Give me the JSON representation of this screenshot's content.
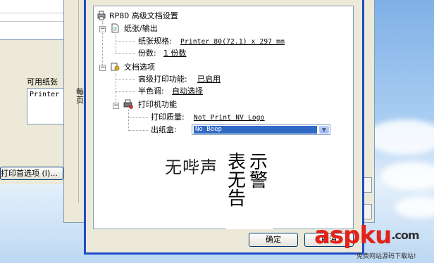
{
  "back_window": {
    "available_paper_label": "可用纸张",
    "printer_list_item": "Printer",
    "print_prefs_button": "打印首选项 (I)..."
  },
  "middle_window": {
    "label_1": "每",
    "label_2": "页"
  },
  "tree": {
    "root": "RP80 高级文档设置",
    "paper_output": "纸张/输出",
    "paper_size_label": "纸张规格:",
    "paper_size_value": "Printer 80(72.1) x 297 mm",
    "copies_label": "份数:",
    "copies_value": "1 份数",
    "doc_options": "文档选项",
    "adv_print_label": "高级打印功能:",
    "adv_print_value": "已启用",
    "halftone_label": "半色调:",
    "halftone_value": "自动选择",
    "printer_features": "打印机功能",
    "print_quality_label": "打印质量:",
    "print_quality_value": "Not Print NV Logo",
    "paper_bin_label": "出纸盒:",
    "paper_bin_value": "No Beep"
  },
  "annotation": {
    "left_text": "无哔声",
    "col1": [
      "表",
      "无",
      "告"
    ],
    "col2": [
      "示",
      "警"
    ]
  },
  "buttons": {
    "ok": "确定",
    "cancel": "取消"
  },
  "watermark": {
    "logo": "aspku",
    "tld": ".com",
    "sub": "免费网站源码下载站!"
  }
}
